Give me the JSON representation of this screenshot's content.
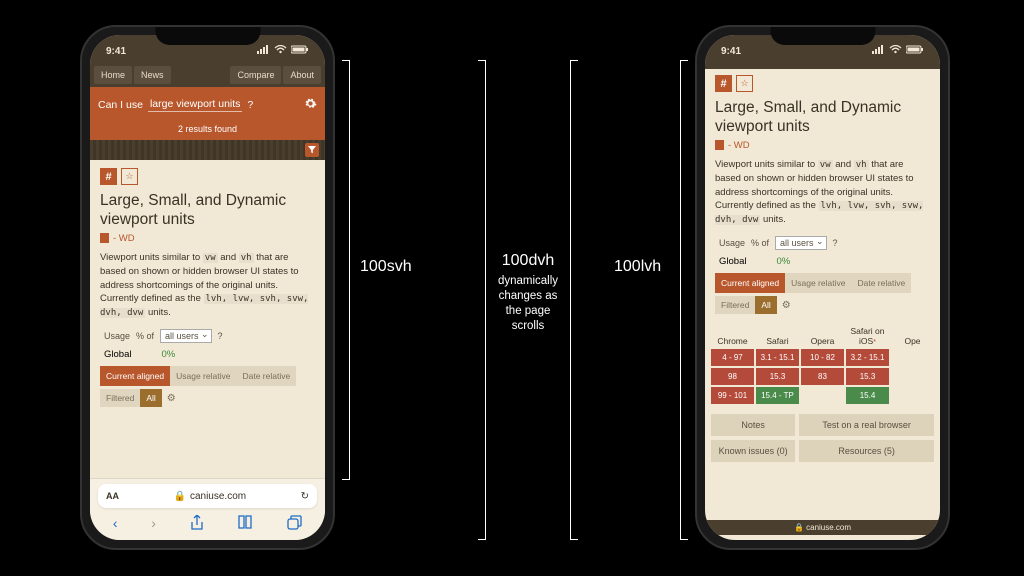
{
  "status": {
    "time": "9:41"
  },
  "nav": {
    "home": "Home",
    "news": "News",
    "compare": "Compare",
    "about": "About"
  },
  "search": {
    "prefix": "Can I use",
    "query": "large viewport units",
    "suffix": "?",
    "results": "2 results found"
  },
  "feature": {
    "title": "Large, Small, and Dynamic viewport units",
    "wd": "- WD",
    "desc_pre": "Viewport units similar to ",
    "desc_mid1": " and ",
    "desc_mid2": " that are based on shown or hidden browser UI states to address shortcomings of the original units. Currently defined as the ",
    "desc_end": " units.",
    "code_vw": "vw",
    "code_vh": "vh",
    "code_list": "lvh, lvw, svh, svw, dvh, dvw"
  },
  "usage": {
    "label": "Usage",
    "pct_of": "% of",
    "selector": "all users",
    "q": "?",
    "global": "Global",
    "value": "0%"
  },
  "tabs": {
    "current": "Current aligned",
    "usage_rel": "Usage relative",
    "date_rel": "Date relative",
    "filtered": "Filtered",
    "all": "All"
  },
  "browsers": {
    "headers": [
      "Chrome",
      "Safari",
      "Opera",
      "Safari on iOS",
      "Ope"
    ],
    "rows": [
      [
        {
          "v": "4 - 97",
          "c": "r"
        },
        {
          "v": "3.1 - 15.1",
          "c": "r"
        },
        {
          "v": "10 - 82",
          "c": "r"
        },
        {
          "v": "3.2 - 15.1",
          "c": "r"
        },
        {
          "v": "",
          "c": "e"
        }
      ],
      [
        {
          "v": "98",
          "c": "r"
        },
        {
          "v": "15.3",
          "c": "r"
        },
        {
          "v": "83",
          "c": "r"
        },
        {
          "v": "15.3",
          "c": "r"
        },
        {
          "v": "",
          "c": "e"
        }
      ],
      [
        {
          "v": "99 - 101",
          "c": "r"
        },
        {
          "v": "15.4 - TP",
          "c": "g"
        },
        {
          "v": "",
          "c": "e"
        },
        {
          "v": "15.4",
          "c": "g"
        },
        {
          "v": "",
          "c": "e"
        }
      ]
    ]
  },
  "bottom": {
    "notes": "Notes",
    "test": "Test on a real browser",
    "issues": "Known issues (0)",
    "resources": "Resources (5)"
  },
  "safari": {
    "aa": "AA",
    "domain": "caniuse.com",
    "mini": "caniuse.com"
  },
  "annotations": {
    "svh": "100svh",
    "dvh": "100dvh",
    "dvh_sub": "dynamically changes as the page scrolls",
    "lvh": "100lvh"
  }
}
